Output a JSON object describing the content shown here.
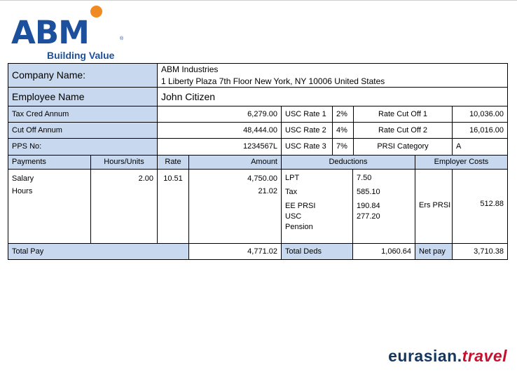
{
  "logo": {
    "brand": "ABM",
    "registered": "®",
    "tagline": "Building Value"
  },
  "company": {
    "label": "Company Name:",
    "name": "ABM Industries",
    "address": "1 Liberty Plaza 7th Floor New York, NY 10006 United States"
  },
  "employee": {
    "label": "Employee Name",
    "name": "John Citizen"
  },
  "rows": {
    "tax_cred": {
      "label": "Tax Cred Annum",
      "value": "6,279.00",
      "usc_label": "USC Rate 1",
      "usc_rate": "2%",
      "cut_label": "Rate Cut Off 1",
      "cut_value": "10,036.00"
    },
    "cut_off": {
      "label": "Cut Off Annum",
      "value": "48,444.00",
      "usc_label": "USC Rate 2",
      "usc_rate": "4%",
      "cut_label": "Rate Cut Off 2",
      "cut_value": "16,016.00"
    },
    "pps": {
      "label": "PPS No:",
      "value": "1234567L",
      "usc_label": "USC Rate 3",
      "usc_rate": "7%",
      "cat_label": "PRSI Category",
      "cat_value": "A"
    }
  },
  "headers": {
    "payments": "Payments",
    "hours": "Hours/Units",
    "rate": "Rate",
    "amount": "Amount",
    "deductions": "Deductions",
    "employer": "Employer Costs"
  },
  "payments": [
    {
      "name": "Salary",
      "hours": "",
      "rate": "",
      "amount": "4,750.00"
    },
    {
      "name": "Hours",
      "hours": "2.00",
      "rate": "10.51",
      "amount": "21.02"
    }
  ],
  "deductions": {
    "lpt": {
      "label": "LPT",
      "value": "7.50"
    },
    "tax": {
      "label": "Tax",
      "value": "585.10"
    },
    "ee_prsi": {
      "label": "EE PRSI",
      "value": "190.84"
    },
    "usc": {
      "label": "USC",
      "value": "277.20"
    },
    "pension": {
      "label": "Pension",
      "value": ""
    }
  },
  "employer": {
    "label": "Ers PRSI",
    "value": "512.88"
  },
  "totals": {
    "pay_label": "Total Pay",
    "pay_value": "4,771.02",
    "deds_label": "Total Deds",
    "deds_value": "1,060.64",
    "net_label": "Net pay",
    "net_value": "3,710.38"
  },
  "footer": {
    "brand_main": "eurasian.",
    "brand_accent": "travel"
  },
  "colors": {
    "header_fill": "#c7d8ef",
    "logo_blue": "#1c4f9c",
    "logo_orange": "#f08a24",
    "brand_navy": "#14365f",
    "brand_red": "#c8102e"
  }
}
